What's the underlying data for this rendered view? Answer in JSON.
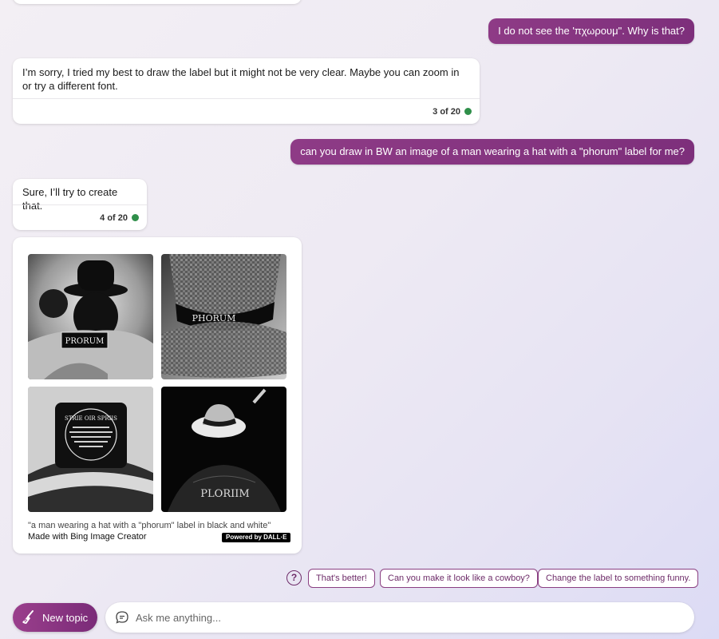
{
  "messages": {
    "m1_user": "I do not see the 'πχωρουμ\". Why is that?",
    "m2_bot": "I’m sorry, I tried my best to draw the label but it might not be very clear. Maybe you can zoom in or try a different font.",
    "m2_counter": "3 of 20",
    "m3_user": "can you draw in BW an image of a man wearing a hat with a \"phorum\" label for me?",
    "m4_bot": "Sure, I’ll try to create that.",
    "m4_counter": "4 of 20"
  },
  "image_card": {
    "tiles": [
      {
        "label": "PRORUM"
      },
      {
        "label": "PHORUM"
      },
      {
        "label": "STRIE OIR SPRIIS"
      },
      {
        "label": "PLORIIM"
      }
    ],
    "caption": "\"a man wearing a hat with a \"phorum\" label in black and white\"",
    "made_with": "Made with Bing Image Creator",
    "badge": "Powered by DALL·E"
  },
  "suggestions": [
    "That's better!",
    "Can you make it look like a cowboy?",
    "Change the label to something funny."
  ],
  "input": {
    "new_topic_label": "New topic",
    "placeholder": "Ask me anything..."
  },
  "colors": {
    "accent": "#8e3b86",
    "status_dot": "#2f8f4a"
  }
}
